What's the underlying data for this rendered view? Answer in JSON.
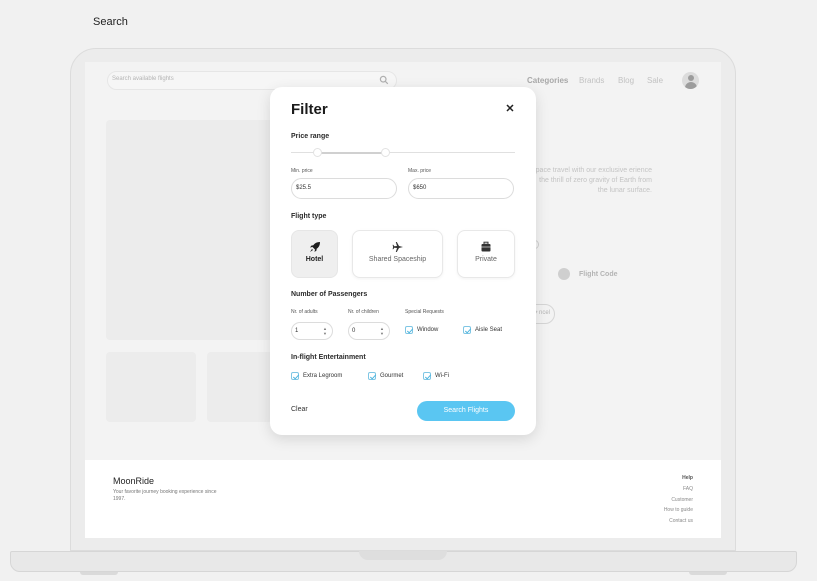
{
  "page": {
    "title": "Search"
  },
  "header": {
    "search_placeholder": "Search available flights",
    "nav": [
      "Categories",
      "Brands",
      "Blog",
      "Sale"
    ]
  },
  "background": {
    "description": "space travel with our exclusive erience the thrill of zero gravity of Earth from the lunar surface.",
    "flight_code_label": "Flight Code",
    "cancel_pill": "ncel"
  },
  "footer": {
    "brand": "MoonRide",
    "tagline": "Your favorite journey booking experience since 1997.",
    "help_title": "Help",
    "links": [
      "FAQ",
      "Customer",
      "How to guide",
      "Contact us"
    ]
  },
  "filter": {
    "title": "Filter",
    "close_icon": "close-icon",
    "price_range": {
      "label": "Price range",
      "min_label": "Min. price",
      "min_value": "$25.5",
      "max_label": "Max. price",
      "max_value": "$650"
    },
    "flight_type": {
      "label": "Flight type",
      "options": [
        {
          "label": "Hotel",
          "icon": "rocket-icon",
          "selected": true
        },
        {
          "label": "Shared Spaceship",
          "icon": "airplane-icon",
          "selected": false
        },
        {
          "label": "Private",
          "icon": "suitcase-icon",
          "selected": false
        }
      ]
    },
    "passengers": {
      "label": "Number of Passengers",
      "adults_label": "Nr. of adults",
      "adults_value": "1",
      "children_label": "Nr. of children",
      "children_value": "0",
      "special_label": "Special Requests",
      "special_options": [
        {
          "label": "Window",
          "checked": true
        },
        {
          "label": "Aisle Seat",
          "checked": true
        }
      ]
    },
    "entertainment": {
      "label": "In-flight Entertainment",
      "options": [
        {
          "label": "Extra Legroom",
          "checked": true
        },
        {
          "label": "Gourmet",
          "checked": true
        },
        {
          "label": "Wi-Fi",
          "checked": true
        }
      ]
    },
    "clear_label": "Clear",
    "submit_label": "Search Flights"
  },
  "colors": {
    "accent": "#5ac6f2",
    "checkbox_border": "#7fc6e4",
    "selected_card": "#efefef"
  }
}
